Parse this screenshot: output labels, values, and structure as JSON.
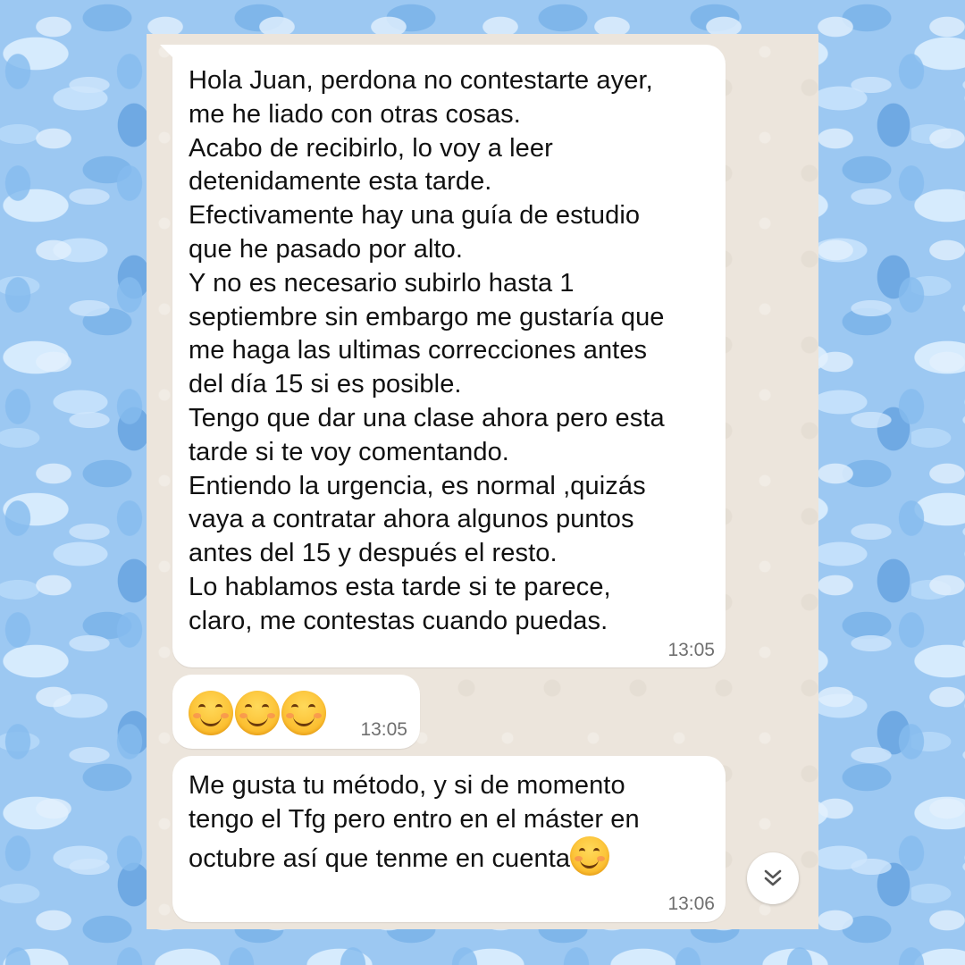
{
  "messages": [
    {
      "text": "Hola Juan, perdona no contestarte ayer,\nme he liado con otras cosas.\nAcabo de recibirlo, lo voy a leer\ndetenidamente esta tarde.\nEfectivamente hay una guía de estudio\nque he pasado por alto.\nY  no es necesario subirlo hasta 1\nseptiembre sin embargo me gustaría que\nme haga las ultimas correcciones antes\ndel día 15 si es posible.\nTengo que dar una clase ahora pero esta\ntarde si te voy comentando.\nEntiendo la urgencia, es normal ,quizás\nvaya a contratar ahora algunos puntos\nantes del 15 y después el resto.\nLo hablamos esta tarde si te parece,\nclaro, me contestas cuando puedas.",
      "time": "13:05"
    },
    {
      "emoji": [
        "smiling-face-icon",
        "smiling-face-icon",
        "smiling-face-icon"
      ],
      "time": "13:05"
    },
    {
      "text": "Me gusta tu método, y si de momento\ntengo el Tfg pero entro en el máster en\noctubre así que tenme en cuenta",
      "trailing_emoji": "smiling-face-icon",
      "time": "13:06"
    }
  ],
  "scroll_button": {
    "icon": "double-chevron-down-icon"
  },
  "colors": {
    "page_background": "#9cc8f2",
    "chat_background": "#ece5dc",
    "bubble": "#ffffff",
    "timestamp": "#6f6f6f"
  }
}
